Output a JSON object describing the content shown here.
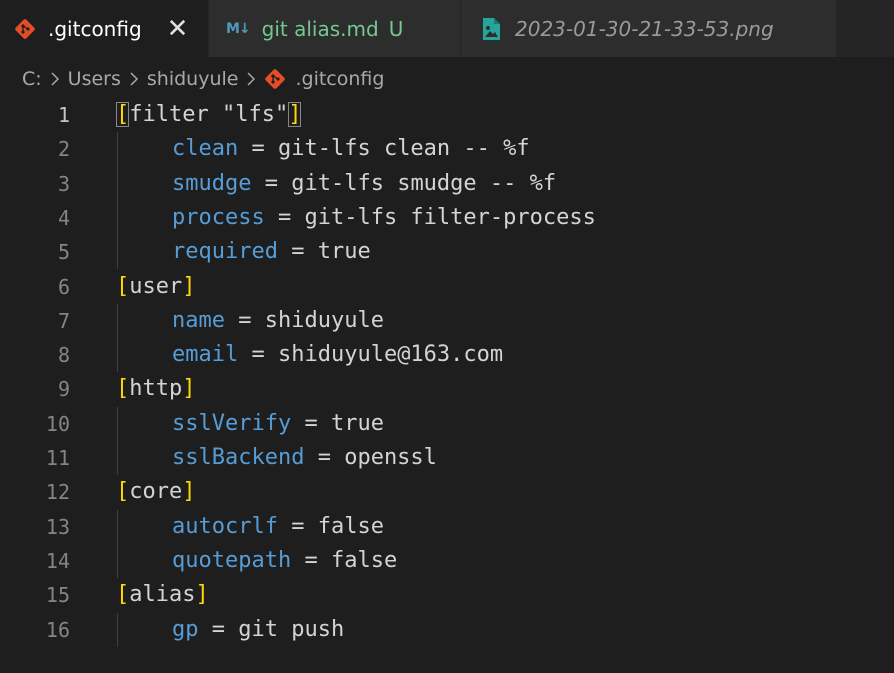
{
  "tabs": [
    {
      "label": ".gitconfig",
      "close": "✕",
      "icon": "git-file-icon"
    },
    {
      "label": "git alias.md",
      "badge": "U",
      "icon_text": "M↓",
      "icon": "markdown-icon"
    },
    {
      "label": "2023-01-30-21-33-53.png",
      "icon": "image-file-icon"
    }
  ],
  "breadcrumb": {
    "items": [
      "C:",
      "Users",
      "shiduyule",
      ".gitconfig"
    ]
  },
  "editor": {
    "lines": [
      {
        "n": "1",
        "section": "filter \"lfs\""
      },
      {
        "n": "2",
        "key": "clean",
        "eq": " = ",
        "value": "git-lfs clean -- %f"
      },
      {
        "n": "3",
        "key": "smudge",
        "eq": " = ",
        "value": "git-lfs smudge -- %f"
      },
      {
        "n": "4",
        "key": "process",
        "eq": " = ",
        "value": "git-lfs filter-process"
      },
      {
        "n": "5",
        "key": "required",
        "eq": " = ",
        "value": "true"
      },
      {
        "n": "6",
        "section": "user"
      },
      {
        "n": "7",
        "key": "name",
        "eq": " = ",
        "value": "shiduyule"
      },
      {
        "n": "8",
        "key": "email",
        "eq": " = ",
        "value": "shiduyule@163.com"
      },
      {
        "n": "9",
        "section": "http"
      },
      {
        "n": "10",
        "key": "sslVerify",
        "eq": " = ",
        "value": "true"
      },
      {
        "n": "11",
        "key": "sslBackend",
        "eq": " = ",
        "value": "openssl"
      },
      {
        "n": "12",
        "section": "core"
      },
      {
        "n": "13",
        "key": "autocrlf",
        "eq": " = ",
        "value": "false"
      },
      {
        "n": "14",
        "key": "quotepath",
        "eq": " = ",
        "value": "false"
      },
      {
        "n": "15",
        "section": "alias"
      },
      {
        "n": "16",
        "key": "gp",
        "eq": " = ",
        "value": "git push"
      }
    ]
  },
  "colors": {
    "key": "#569cd6",
    "bracket": "#ffd700",
    "untracked": "#73c991",
    "git_icon": "#e44d26",
    "image_icon": "#26a69a"
  }
}
